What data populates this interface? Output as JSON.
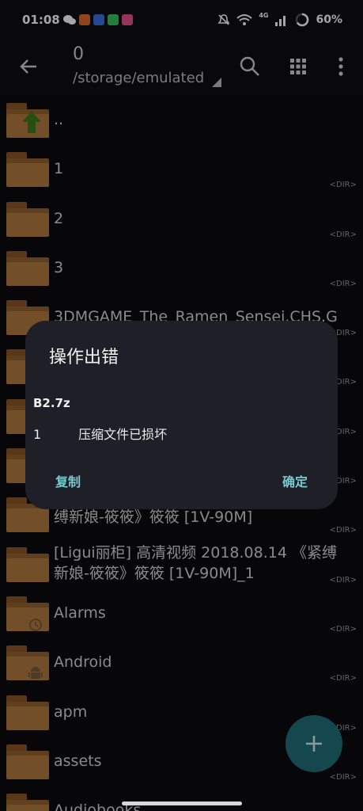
{
  "status": {
    "time": "01:08",
    "battery": "60%",
    "network": "4G",
    "apps": [
      "#e06b2a",
      "#3b6fe0",
      "#38c15a",
      "#e7518e"
    ]
  },
  "toolbar": {
    "count": "0",
    "path": "/storage/emulated"
  },
  "files": [
    {
      "name": "..",
      "dir": "",
      "up": true
    },
    {
      "name": "1",
      "dir": "<DIR>"
    },
    {
      "name": "2",
      "dir": "<DIR>"
    },
    {
      "name": "3",
      "dir": "<DIR>"
    },
    {
      "name": "3DMGAME_The_Ramen_Sensei.CHS.G",
      "dir": "<DIR>"
    },
    {
      "name": "",
      "dir": "<DIR>"
    },
    {
      "name": "",
      "dir": "<DIR>"
    },
    {
      "name": "",
      "dir": "<DIR>"
    },
    {
      "name": "缚新娘-筱筱》筱筱 [1V-90M]",
      "dir": "<DIR>"
    },
    {
      "name": "[Ligui丽柜] 高清视频 2018.08.14 《紧缚新娘-筱筱》筱筱 [1V-90M]_1",
      "dir": "<DIR>"
    },
    {
      "name": "Alarms",
      "dir": "<DIR>",
      "badge": "alarm"
    },
    {
      "name": "Android",
      "dir": "<DIR>",
      "badge": "android"
    },
    {
      "name": "apm",
      "dir": "<DIR>"
    },
    {
      "name": "assets",
      "dir": "<DIR>"
    },
    {
      "name": "Audiobooks",
      "dir": ""
    }
  ],
  "dialog": {
    "title": "操作出错",
    "file": "B2.7z",
    "line_num": "1",
    "line_msg": "压缩文件已损坏",
    "copy_label": "复制",
    "ok_label": "确定"
  },
  "colors": {
    "accent": "#79c7cf",
    "fab": "#1f6e78",
    "folder": "#b07a3e"
  }
}
